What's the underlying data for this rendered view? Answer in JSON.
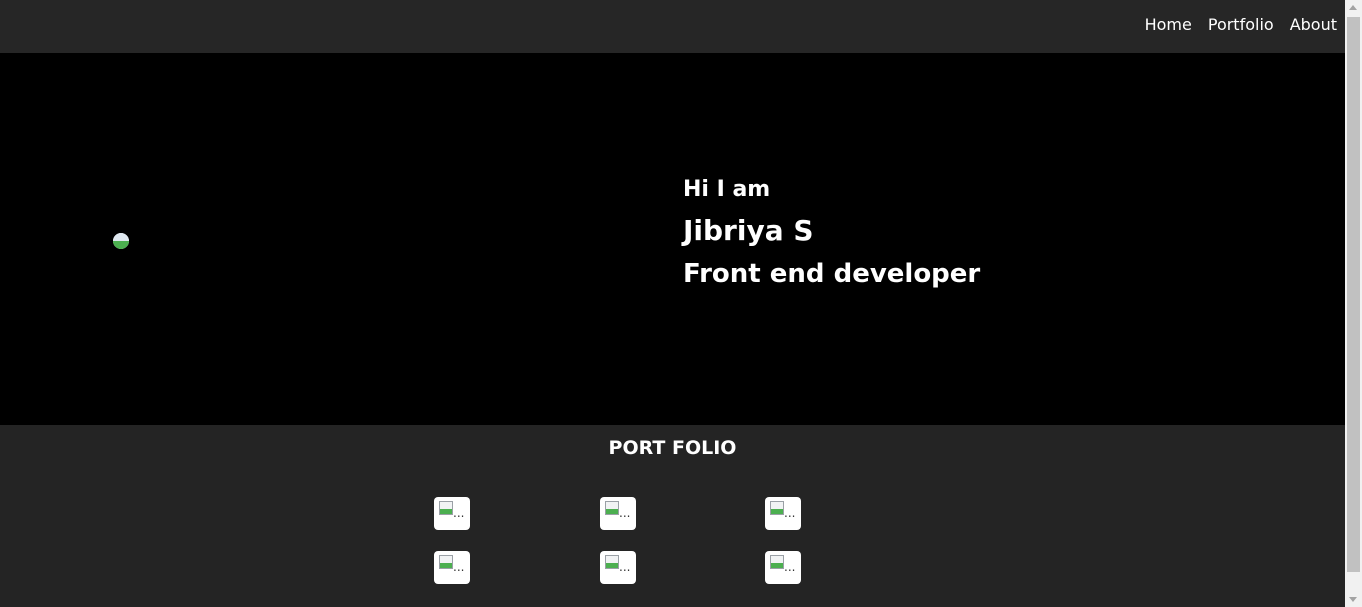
{
  "nav": {
    "links": [
      "Home",
      "Portfolio",
      "About"
    ]
  },
  "hero": {
    "greeting": "Hi I am",
    "name": "Jibriya S",
    "role": "Front end developer"
  },
  "portfolio": {
    "title": "PORT FOLIO",
    "thumb_alt": "..."
  },
  "colors": {
    "navbar_bg": "#262626",
    "hero_bg": "#000000",
    "portfolio_bg": "#242424",
    "text": "#ffffff"
  }
}
